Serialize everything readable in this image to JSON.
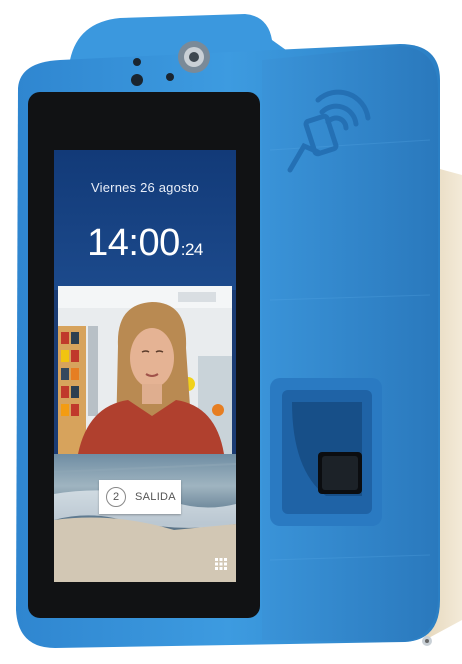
{
  "screen": {
    "date": "Viernes 26 agosto",
    "time_main": "14:00",
    "time_seconds": ":24"
  },
  "actions": {
    "salida_number": "2",
    "salida_label": "SALIDA"
  },
  "icons": {
    "grid": "grid-icon",
    "nfc": "contactless-card-icon",
    "camera": "camera-icon",
    "fingerprint": "fingerprint-reader"
  },
  "colors": {
    "housing": "#3a96dc",
    "screen_top": "#1c4a8c",
    "button": "#ffffff"
  }
}
